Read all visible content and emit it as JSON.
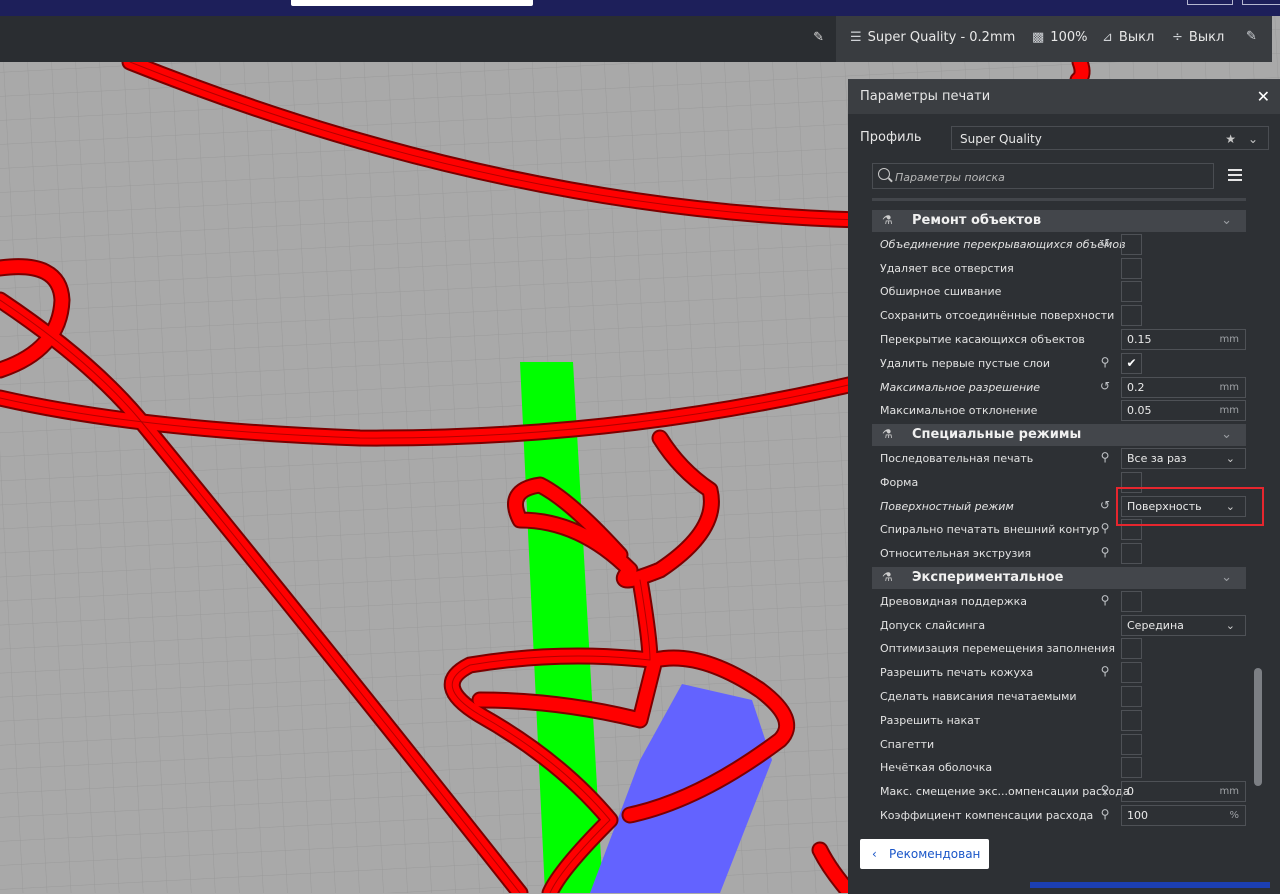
{
  "colors": {
    "print_path": "#ff0000",
    "support": "#00ff00",
    "skin": "#6363ff",
    "build_plate": "#a9a9a9",
    "panel_bg": "#2d3034",
    "highlight": "#e6262e",
    "accent_link": "#1a56c8"
  },
  "printbar": {
    "profile_icon": "layers-icon",
    "profile": "Super Quality - 0.2mm",
    "infill_icon": "infill-icon",
    "infill": "100%",
    "support_icon": "support-icon",
    "support": "Выкл",
    "adhesion_icon": "adhesion-icon",
    "adhesion": "Выкл",
    "edit_icon": "pencil-icon"
  },
  "toolbar": {
    "edit_icon": "pencil-icon"
  },
  "panel": {
    "title": "Параметры печати",
    "close": "✕",
    "profile_label": "Профиль",
    "profile_value": "Super Quality",
    "search_placeholder": "Параметры поиска",
    "recommended_button": "Рекомендован",
    "recommended_arrow": "‹"
  },
  "categories": [
    {
      "label": "Ремонт объектов",
      "icon": "mesh-fix-icon",
      "glyph": "⚗"
    },
    {
      "label": "Специальные режимы",
      "icon": "special-modes-icon",
      "glyph": "⚗"
    },
    {
      "label": "Экспериментальное",
      "icon": "experimental-flask-icon",
      "glyph": "⚗"
    }
  ],
  "rows": [
    {
      "label": "Объединение перекрывающихся объёмов",
      "italic": true,
      "icon": "reset",
      "type": "checkbox",
      "checked": false
    },
    {
      "label": "Удаляет все отверстия",
      "type": "checkbox",
      "checked": false
    },
    {
      "label": "Обширное сшивание",
      "type": "checkbox",
      "checked": false
    },
    {
      "label": "Сохранить отсоединённые поверхности",
      "type": "checkbox",
      "checked": false
    },
    {
      "label": "Перекрытие касающихся объектов",
      "type": "number",
      "value": "0.15",
      "unit": "mm"
    },
    {
      "label": "Удалить первые пустые слои",
      "icon": "link",
      "type": "checkbox",
      "checked": true
    },
    {
      "label": "Максимальное разрешение",
      "italic": true,
      "icon": "reset",
      "type": "number",
      "value": "0.2",
      "unit": "mm"
    },
    {
      "label": "Максимальное отклонение",
      "type": "number",
      "value": "0.05",
      "unit": "mm"
    },
    {
      "label": "Последовательная печать",
      "icon": "link",
      "type": "select",
      "value": "Все за раз"
    },
    {
      "label": "Форма",
      "type": "checkbox",
      "checked": false
    },
    {
      "label": "Поверхностный режим",
      "italic": true,
      "icon": "reset",
      "type": "select",
      "value": "Поверхность"
    },
    {
      "label": "Спирально печатать внешний контур",
      "icon": "link",
      "type": "checkbox",
      "checked": false
    },
    {
      "label": "Относительная экструзия",
      "icon": "link",
      "type": "checkbox",
      "checked": false
    },
    {
      "label": "Древовидная поддержка",
      "icon": "link",
      "type": "checkbox",
      "checked": false
    },
    {
      "label": "Допуск слайсинга",
      "type": "select",
      "value": "Середина"
    },
    {
      "label": "Оптимизация перемещения заполнения",
      "type": "checkbox",
      "checked": false
    },
    {
      "label": "Разрешить печать кожуха",
      "icon": "link",
      "type": "checkbox",
      "checked": false
    },
    {
      "label": "Сделать нависания печатаемыми",
      "type": "checkbox",
      "checked": false
    },
    {
      "label": "Разрешить накат",
      "type": "checkbox",
      "checked": false
    },
    {
      "label": "Спагетти",
      "type": "checkbox",
      "checked": false
    },
    {
      "label": "Нечёткая оболочка",
      "type": "checkbox",
      "checked": false
    },
    {
      "label": "Макс. смещение экс...омпенсации расхода",
      "icon": "link",
      "type": "number",
      "value": "0",
      "unit": "mm"
    },
    {
      "label": "Коэффициент компенсации расхода",
      "icon": "link",
      "type": "number",
      "value": "100",
      "unit": "%"
    }
  ]
}
